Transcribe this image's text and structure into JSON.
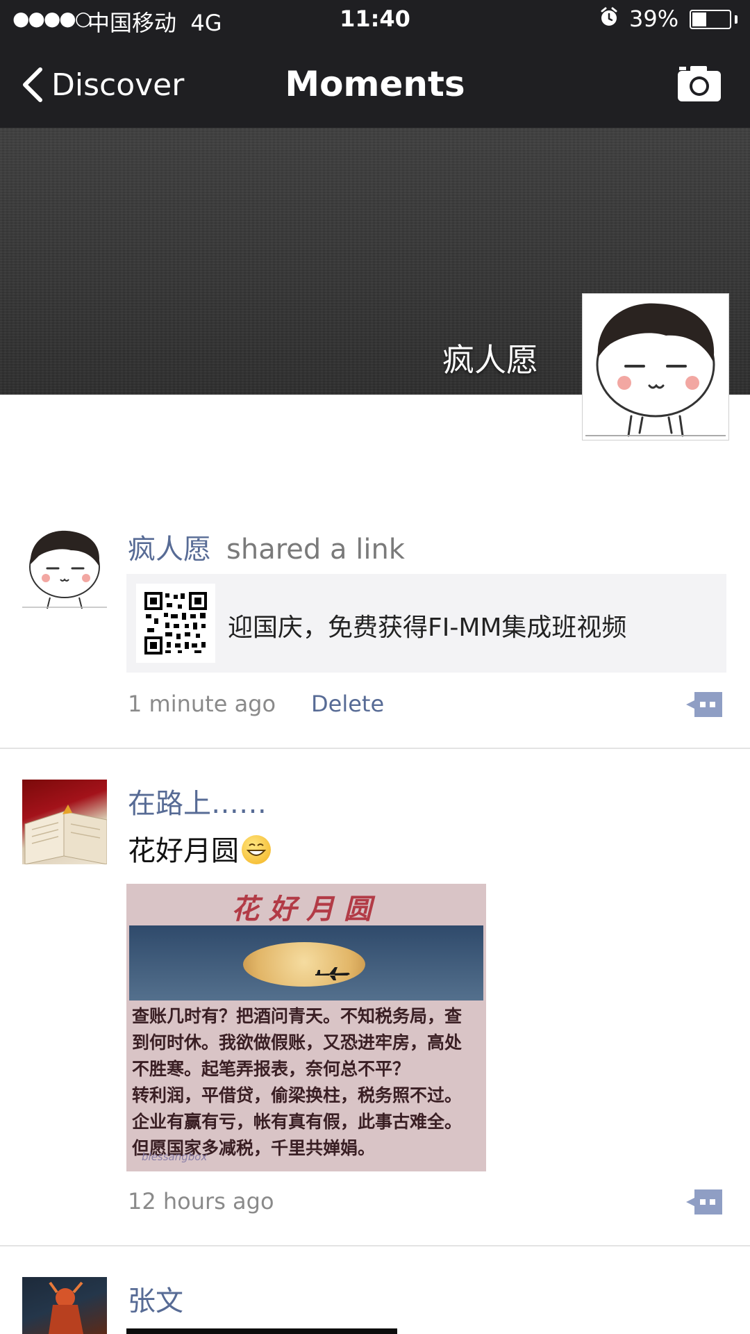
{
  "status_bar": {
    "signal": "●●●●○",
    "carrier": "中国移动",
    "network": "4G",
    "time": "11:40",
    "battery_percent": "39%",
    "battery_level": 0.39
  },
  "nav": {
    "back_label": "Discover",
    "title": "Moments"
  },
  "cover": {
    "user_name": "疯人愿"
  },
  "posts": [
    {
      "author": "疯人愿",
      "action": "shared a link",
      "link_title": "迎国庆，免费获得FI-MM集成班视频",
      "time": "1 minute ago",
      "delete_label": "Delete"
    },
    {
      "author": "在路上……",
      "text": "花好月圆",
      "image_title": "花好月圆",
      "image_poem": "查账几时有？把酒问青天。不知税务局，查\n到何时休。我欲做假账，又恐进牢房，高处\n不胜寒。起笔弄报表，奈何总不平？\n转利润，平借贷，偷梁换柱，税务照不过。\n企业有赢有亏，帐有真有假，此事古难全。\n但愿国家多减税，千里共婵娟。",
      "image_footer": "blessangbox",
      "time": "12 hours ago"
    },
    {
      "author": "张文"
    }
  ],
  "colors": {
    "bar": "#1f1f22",
    "link_blue": "#576b95",
    "meta_gray": "#8a8a8a"
  }
}
